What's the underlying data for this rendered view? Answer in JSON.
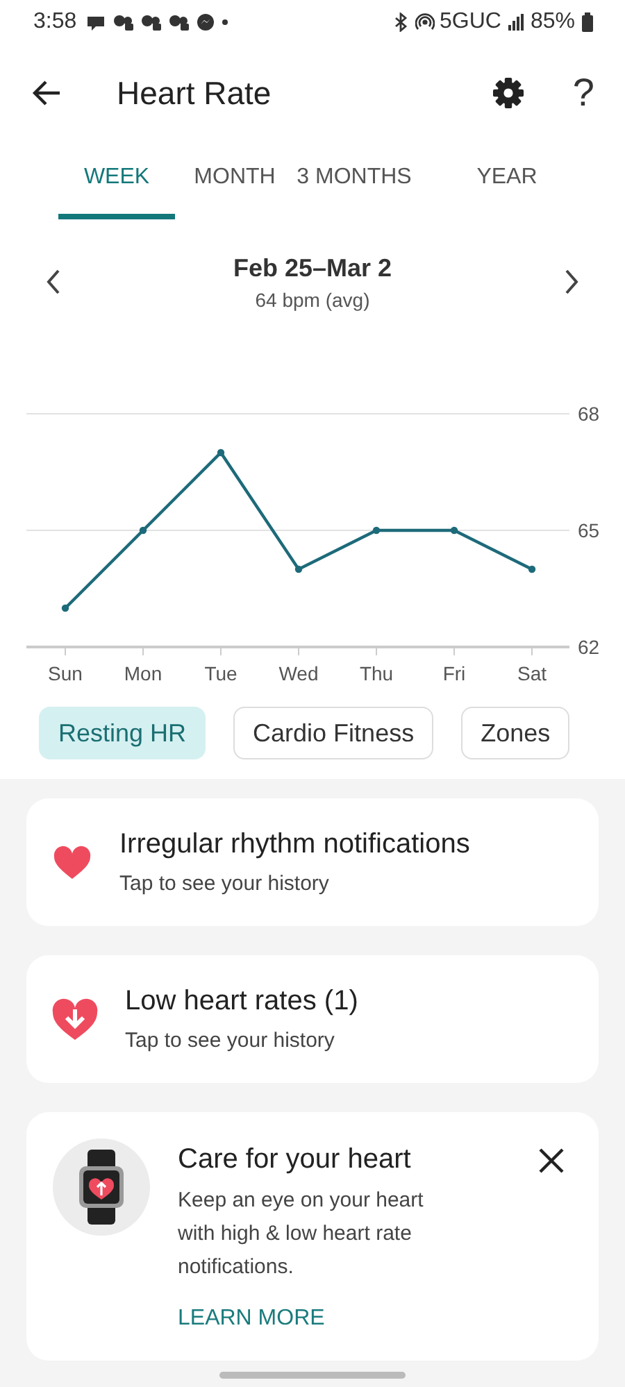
{
  "status_bar": {
    "time": "3:58",
    "network": "5GUC",
    "battery": "85%"
  },
  "header": {
    "title": "Heart Rate",
    "help": "?"
  },
  "tabs": [
    {
      "label": "WEEK",
      "selected": true
    },
    {
      "label": "MONTH",
      "selected": false
    },
    {
      "label": "3 MONTHS",
      "selected": false
    },
    {
      "label": "YEAR",
      "selected": false
    }
  ],
  "period": {
    "title": "Feb 25–Mar 2",
    "subtitle": "64 bpm (avg)"
  },
  "chart_data": {
    "type": "line",
    "categories": [
      "Sun",
      "Mon",
      "Tue",
      "Wed",
      "Thu",
      "Fri",
      "Sat"
    ],
    "series": [
      {
        "color": "#1d6a7a",
        "marker": "circle",
        "values": [
          63,
          65,
          67,
          64,
          65,
          65,
          64
        ]
      }
    ],
    "ylim": [
      62,
      68
    ],
    "yticks": [
      62,
      65,
      68
    ]
  },
  "chips": [
    {
      "label": "Resting HR",
      "selected": true
    },
    {
      "label": "Cardio Fitness",
      "selected": false
    },
    {
      "label": "Zones",
      "selected": false
    }
  ],
  "history_cards": [
    {
      "title": "Irregular rhythm notifications",
      "subtitle": "Tap to see your history"
    },
    {
      "title": "Low heart rates (1)",
      "subtitle": "Tap to see your history"
    }
  ],
  "promo": {
    "title": "Care for your heart",
    "body": "Keep an eye on your heart with high & low heart rate notifications.",
    "link": "LEARN MORE"
  }
}
